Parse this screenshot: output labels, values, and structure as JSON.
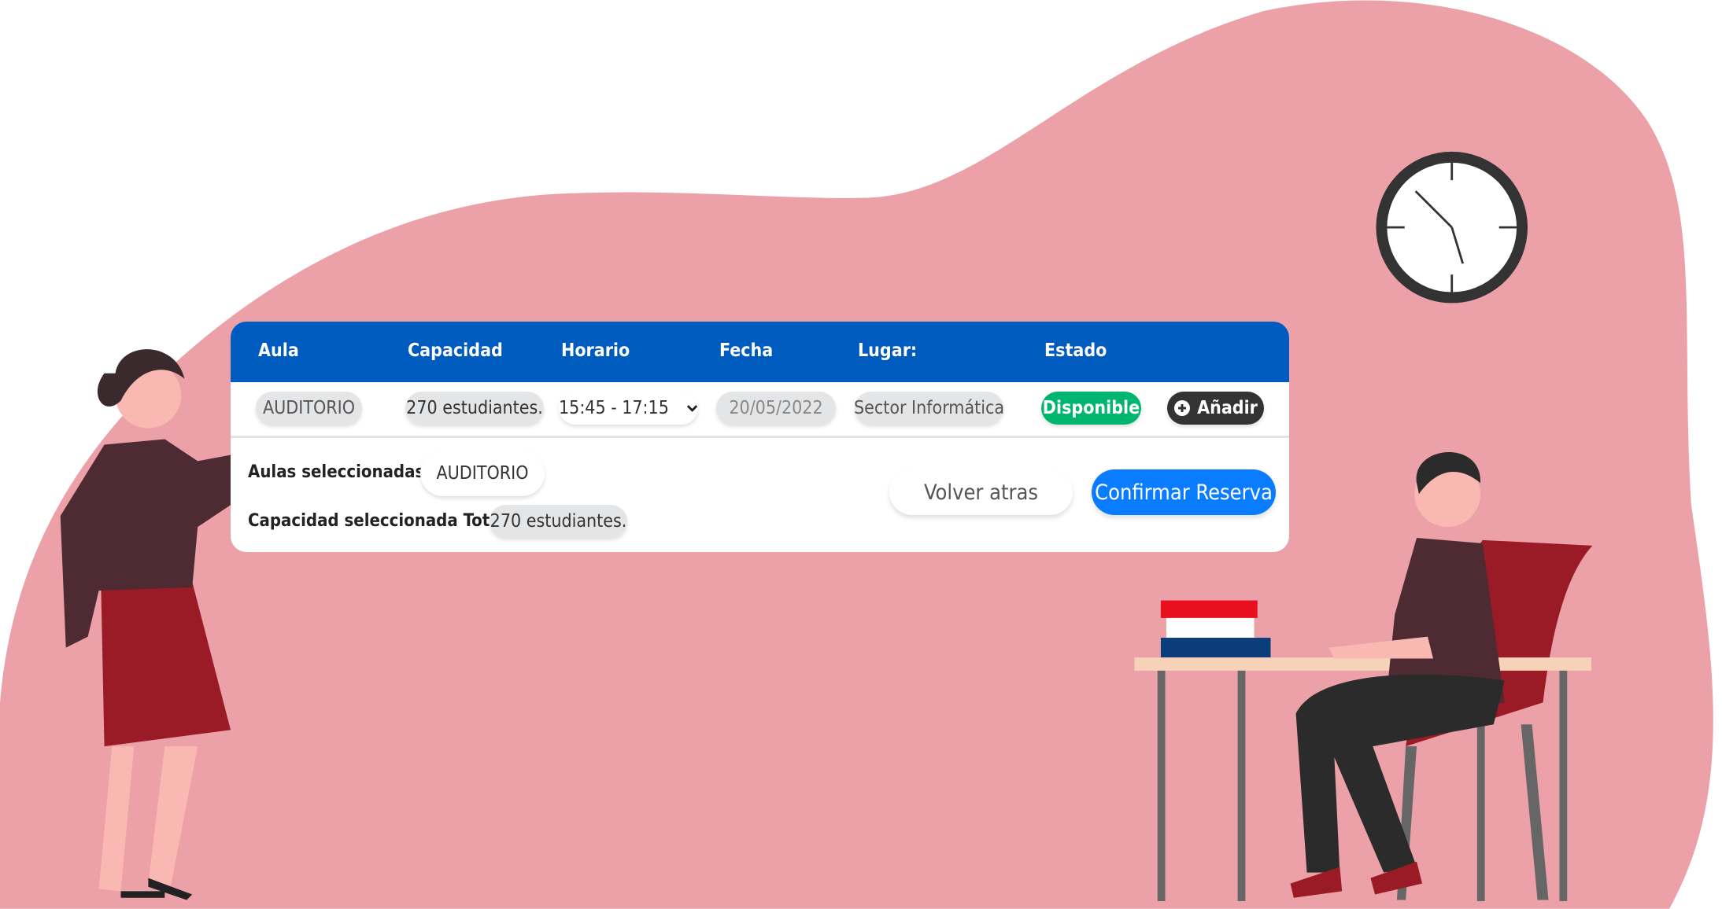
{
  "colors": {
    "header": "#005bbf",
    "available": "#00b56f",
    "add": "#333333",
    "confirm": "#0a7cff",
    "background_blob": "#eca0a7"
  },
  "table": {
    "headers": [
      "Aula",
      "Capacidad",
      "Horario",
      "Fecha",
      "Lugar:",
      "Estado"
    ],
    "row": {
      "aula": "AUDITORIO",
      "capacidad": "270 estudiantes.",
      "horario": "15:45 - 17:15",
      "fecha": "20/05/2022",
      "lugar": "Sector Informática",
      "estado": "Disponible",
      "add_label": "Añadir"
    }
  },
  "summary": {
    "aulas_label": "Aulas seleccionadas:",
    "aulas_value": "AUDITORIO",
    "capacidad_label": "Capacidad seleccionada Total:",
    "capacidad_value": "270 estudiantes."
  },
  "actions": {
    "back": "Volver atras",
    "confirm": "Confirmar Reserva"
  },
  "icons": {
    "add": "plus-circle-icon",
    "dropdown": "chevron-down-icon",
    "clock": "clock-icon"
  }
}
